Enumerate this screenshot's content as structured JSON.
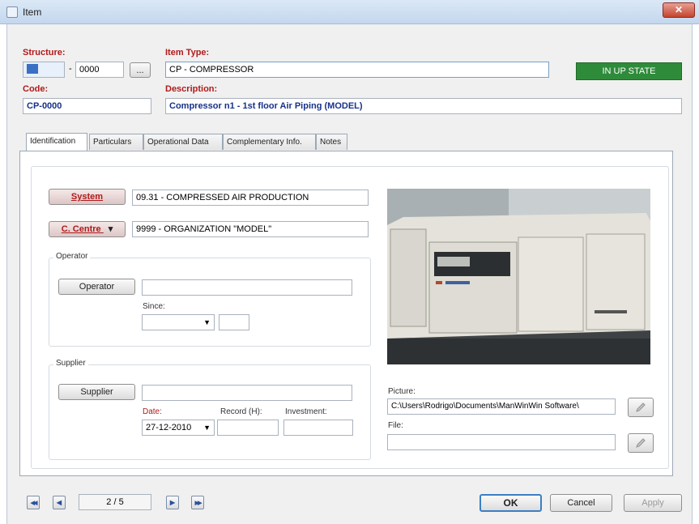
{
  "window": {
    "title": "Item",
    "close_glyph": "✕"
  },
  "header": {
    "structure_label": "Structure:",
    "structure_value": "",
    "structure_sep": "-",
    "structure_code": "0000",
    "structure_browse": "...",
    "item_type_label": "Item Type:",
    "item_type_value": "CP - COMPRESSOR",
    "status": "IN UP STATE",
    "code_label": "Code:",
    "code_value": "CP-0000",
    "description_label": "Description:",
    "description_value": "Compressor n1 - 1st floor Air Piping (MODEL)"
  },
  "tabs": [
    {
      "label": "Identification"
    },
    {
      "label": "Particulars"
    },
    {
      "label": "Operational Data"
    },
    {
      "label": "Complementary Info."
    },
    {
      "label": "Notes"
    }
  ],
  "identification": {
    "system_button": "System",
    "system_value": "09.31 - COMPRESSED AIR PRODUCTION",
    "ccentre_button": "C. Centre",
    "ccentre_arrow": "▾",
    "ccentre_value": "9999 - ORGANIZATION \"MODEL\"",
    "operator_group": "Operator",
    "operator_button": "Operator",
    "operator_value": "",
    "since_label": "Since:",
    "since_value": "",
    "supplier_group": "Supplier",
    "supplier_button": "Supplier",
    "supplier_value": "",
    "date_label": "Date:",
    "date_value": "27-12-2010",
    "record_label": "Record (H):",
    "record_value": "",
    "investment_label": "Investment:",
    "investment_value": "",
    "picture_label": "Picture:",
    "picture_value": "C:\\Users\\Rodrigo\\Documents\\ManWinWin Software\\",
    "file_label": "File:",
    "file_value": "",
    "dropdown_glyph": "▼"
  },
  "footer": {
    "first_glyph": "◀◀",
    "prev_glyph": "◀",
    "page_indicator": "2 / 5",
    "next_glyph": "▶",
    "last_glyph": "▶▶",
    "ok_label": "OK",
    "cancel_label": "Cancel",
    "apply_label": "Apply"
  },
  "colors": {
    "status_green": "#2e8b3a",
    "label_red": "#b01a1a"
  },
  "icons": [
    "item-window-icon",
    "close-icon",
    "pencil-icon",
    "first-record-icon",
    "prev-record-icon",
    "next-record-icon",
    "last-record-icon"
  ]
}
